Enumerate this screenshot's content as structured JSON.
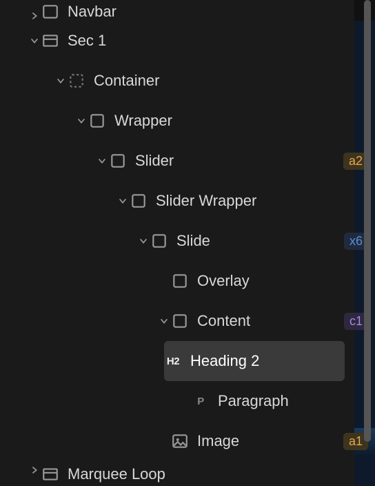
{
  "tree": {
    "navbar": "Navbar",
    "sec1": "Sec 1",
    "container": "Container",
    "wrapper": "Wrapper",
    "slider": "Slider",
    "slider_badge": "a2",
    "slider_wrapper": "Slider Wrapper",
    "slide": "Slide",
    "slide_badge": "x6",
    "overlay": "Overlay",
    "content": "Content",
    "content_badge": "c1",
    "heading2": "Heading 2",
    "heading2_tag": "H2",
    "paragraph": "Paragraph",
    "paragraph_tag": "P",
    "image": "Image",
    "image_badge": "a1",
    "marquee": "Marquee Loop"
  }
}
